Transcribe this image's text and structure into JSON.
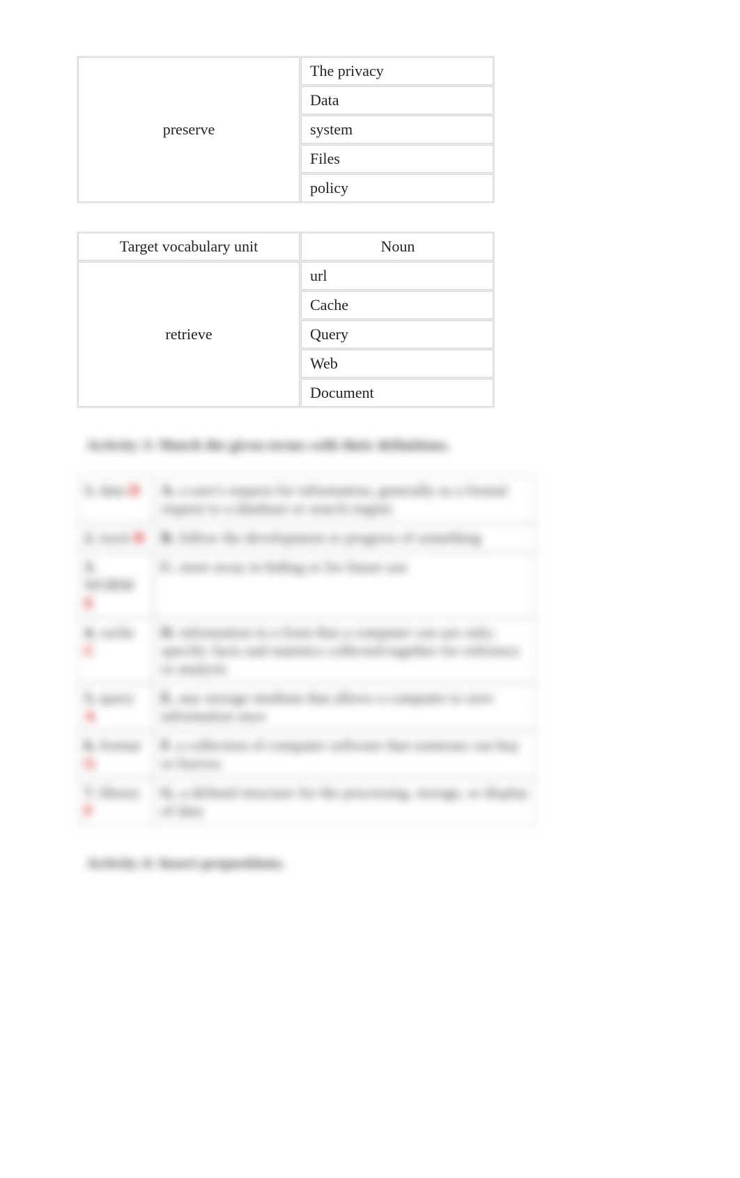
{
  "table1": {
    "vocab": "preserve",
    "nouns": [
      "The privacy",
      "Data",
      "system",
      "Files",
      "policy"
    ]
  },
  "table2": {
    "header_left": "Target vocabulary unit",
    "header_right": "Noun",
    "vocab": "retrieve",
    "nouns": [
      "url",
      "Cache",
      "Query",
      "Web",
      "Document"
    ]
  },
  "activity3": {
    "title": "Activity 3: Match the given terms with their definitions.",
    "rows": [
      {
        "num": "1.",
        "term": "data",
        "ans": "D",
        "let": "A.",
        "def": "a user's request for information, generally as a formal request to a database or search engine"
      },
      {
        "num": "2.",
        "term": "track",
        "ans": "B",
        "let": "B.",
        "def": "follow the development or progress of something"
      },
      {
        "num": "3.",
        "term": "WORM",
        "ans": "E",
        "let": "C.",
        "def": "store away in hiding or for future use"
      },
      {
        "num": "4.",
        "term": "cache",
        "ans": "C",
        "let": "D.",
        "def": "information in a form that a computer can use only; specific facts and statistics collected together for reference or analysis"
      },
      {
        "num": "5.",
        "term": "query",
        "ans": "A",
        "let": "E.",
        "def": "any storage medium that allows a computer to save information once"
      },
      {
        "num": "6.",
        "term": "format",
        "ans": "G",
        "let": "F.",
        "def": "a collection of computer software that someone can buy or borrow"
      },
      {
        "num": "7.",
        "term": "library",
        "ans": "F",
        "let": "G.",
        "def": "a defined structure for the processing, storage, or display of data"
      }
    ]
  },
  "activity4": {
    "title": "Activity 4: Insert prepositions."
  }
}
